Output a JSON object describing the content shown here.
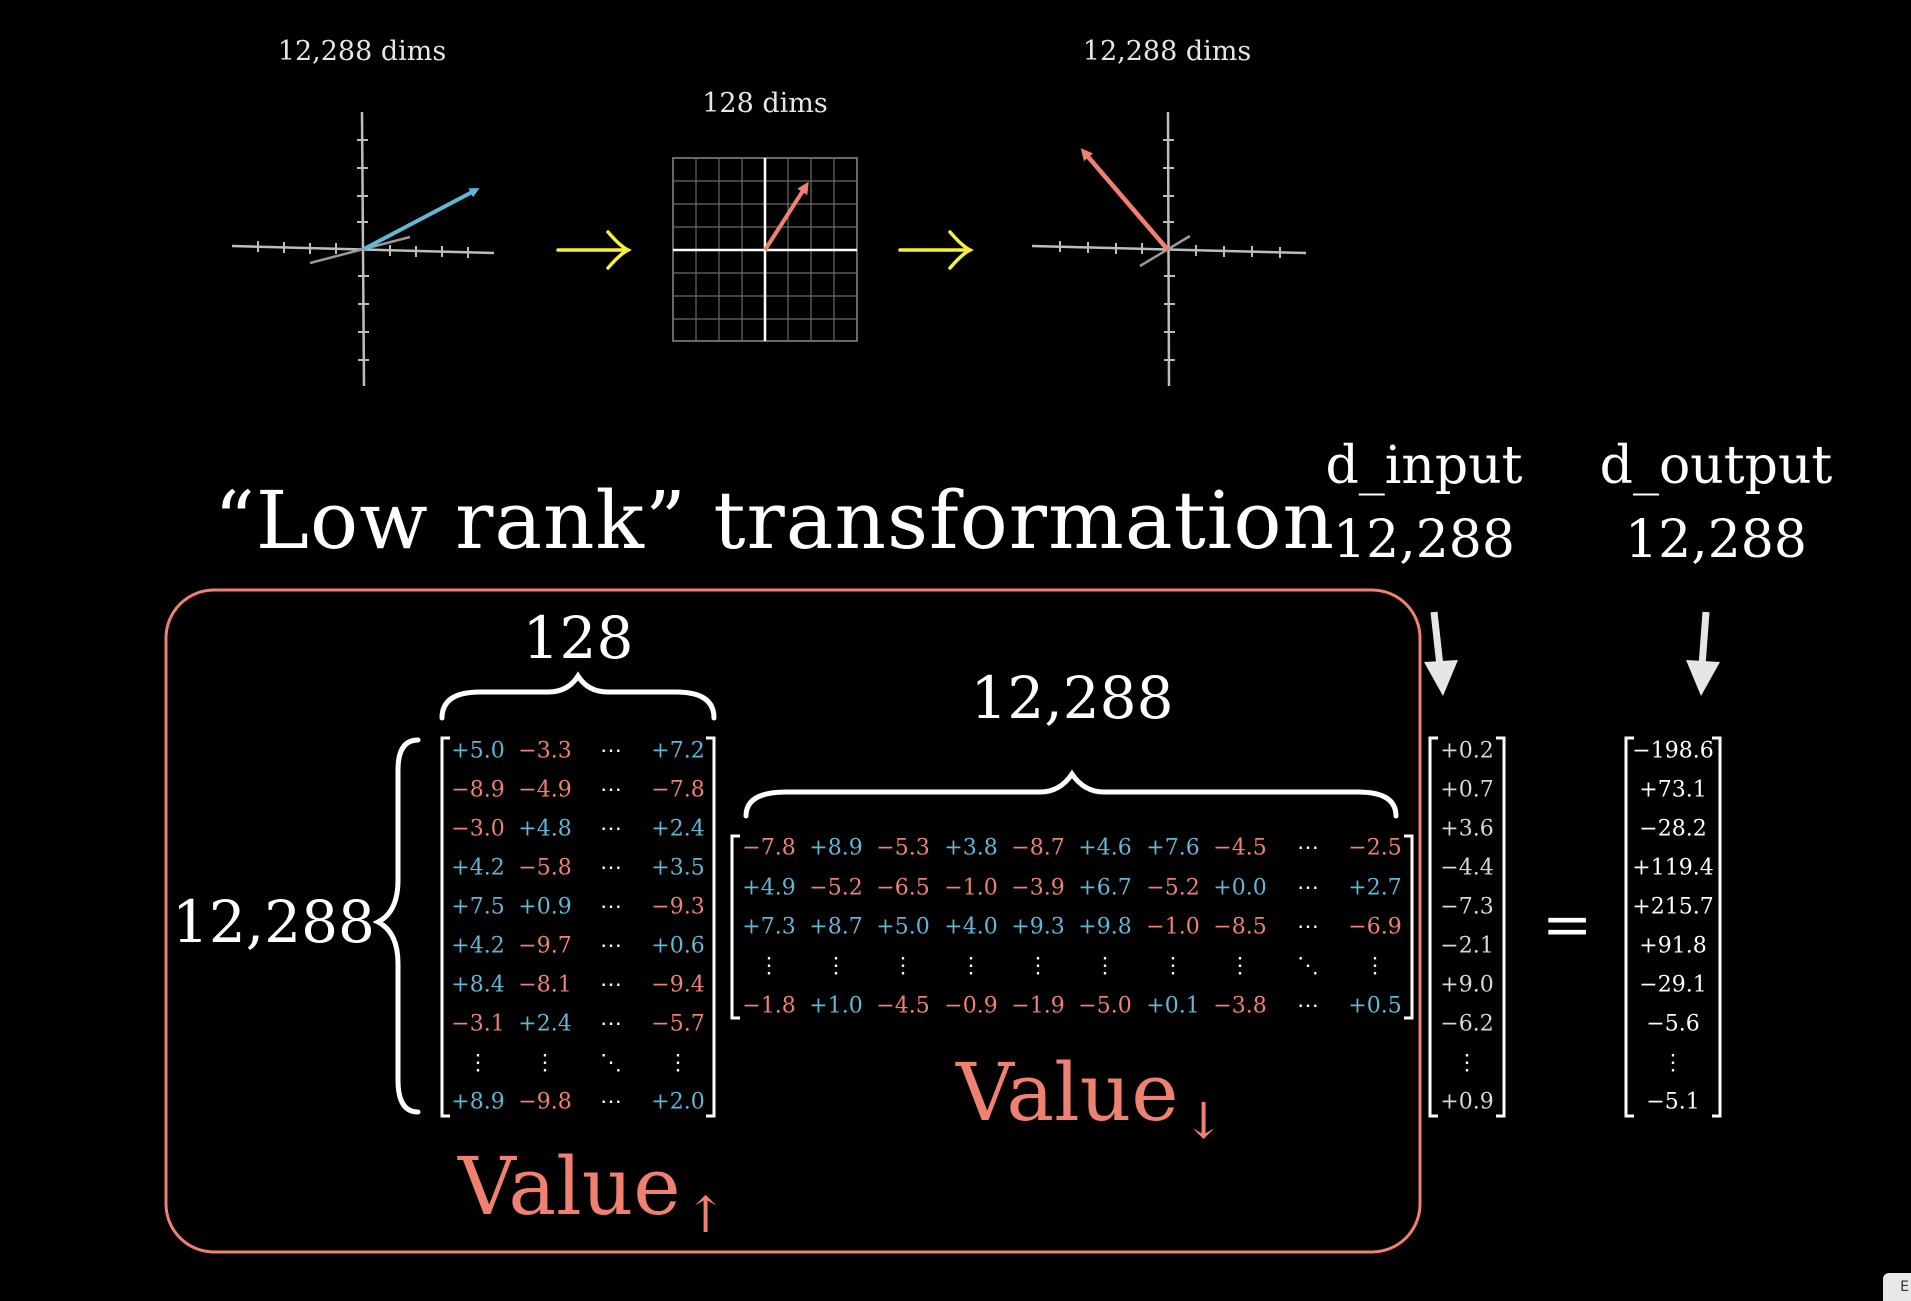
{
  "top": {
    "left_dims": "12,288 dims",
    "middle_dims": "128 dims",
    "right_dims": "12,288 dims",
    "colors": {
      "up_vector": "#5fb8d8",
      "down_vector": "#f08070",
      "arrow": "#f5f03c"
    }
  },
  "title": "“Low rank” transformation",
  "d_input": {
    "label": "d_input",
    "value": "12,288"
  },
  "d_output": {
    "label": "d_output",
    "value": "12,288"
  },
  "value_up": {
    "brace_label": "128",
    "side_label": "12,288",
    "name": "Value",
    "arrow_glyph": "↑",
    "rows": [
      [
        "+5.0",
        "−3.3",
        "⋯",
        "+7.2"
      ],
      [
        "−8.9",
        "−4.9",
        "⋯",
        "−7.8"
      ],
      [
        "−3.0",
        "+4.8",
        "⋯",
        "+2.4"
      ],
      [
        "+4.2",
        "−5.8",
        "⋯",
        "+3.5"
      ],
      [
        "+7.5",
        "+0.9",
        "⋯",
        "−9.3"
      ],
      [
        "+4.2",
        "−9.7",
        "⋯",
        "+0.6"
      ],
      [
        "+8.4",
        "−8.1",
        "⋯",
        "−9.4"
      ],
      [
        "−3.1",
        "+2.4",
        "⋯",
        "−5.7"
      ],
      [
        "⋮",
        "⋮",
        "⋱",
        "⋮"
      ],
      [
        "+8.9",
        "−9.8",
        "⋯",
        "+2.0"
      ]
    ]
  },
  "value_down": {
    "brace_label": "12,288",
    "name": "Value",
    "arrow_glyph": "↓",
    "rows": [
      [
        "−7.8",
        "+8.9",
        "−5.3",
        "+3.8",
        "−8.7",
        "+4.6",
        "+7.6",
        "−4.5",
        "⋯",
        "−2.5"
      ],
      [
        "+4.9",
        "−5.2",
        "−6.5",
        "−1.0",
        "−3.9",
        "+6.7",
        "−5.2",
        "+0.0",
        "⋯",
        "+2.7"
      ],
      [
        "+7.3",
        "+8.7",
        "+5.0",
        "+4.0",
        "+9.3",
        "+9.8",
        "−1.0",
        "−8.5",
        "⋯",
        "−6.9"
      ],
      [
        "⋮",
        "⋮",
        "⋮",
        "⋮",
        "⋮",
        "⋮",
        "⋮",
        "⋮",
        "⋱",
        "⋮"
      ],
      [
        "−1.8",
        "+1.0",
        "−4.5",
        "−0.9",
        "−1.9",
        "−5.0",
        "+0.1",
        "−3.8",
        "⋯",
        "+0.5"
      ]
    ]
  },
  "input_vector": [
    "+0.2",
    "+0.7",
    "+3.6",
    "−4.4",
    "−7.3",
    "−2.1",
    "+9.0",
    "−6.2",
    "⋮",
    "+0.9"
  ],
  "equals": "=",
  "output_vector": [
    "−198.6",
    "+73.1",
    "−28.2",
    "+119.4",
    "+215.7",
    "+91.8",
    "−29.1",
    "−5.6",
    "⋮",
    "−5.1"
  ],
  "corner_tab_label": "E"
}
